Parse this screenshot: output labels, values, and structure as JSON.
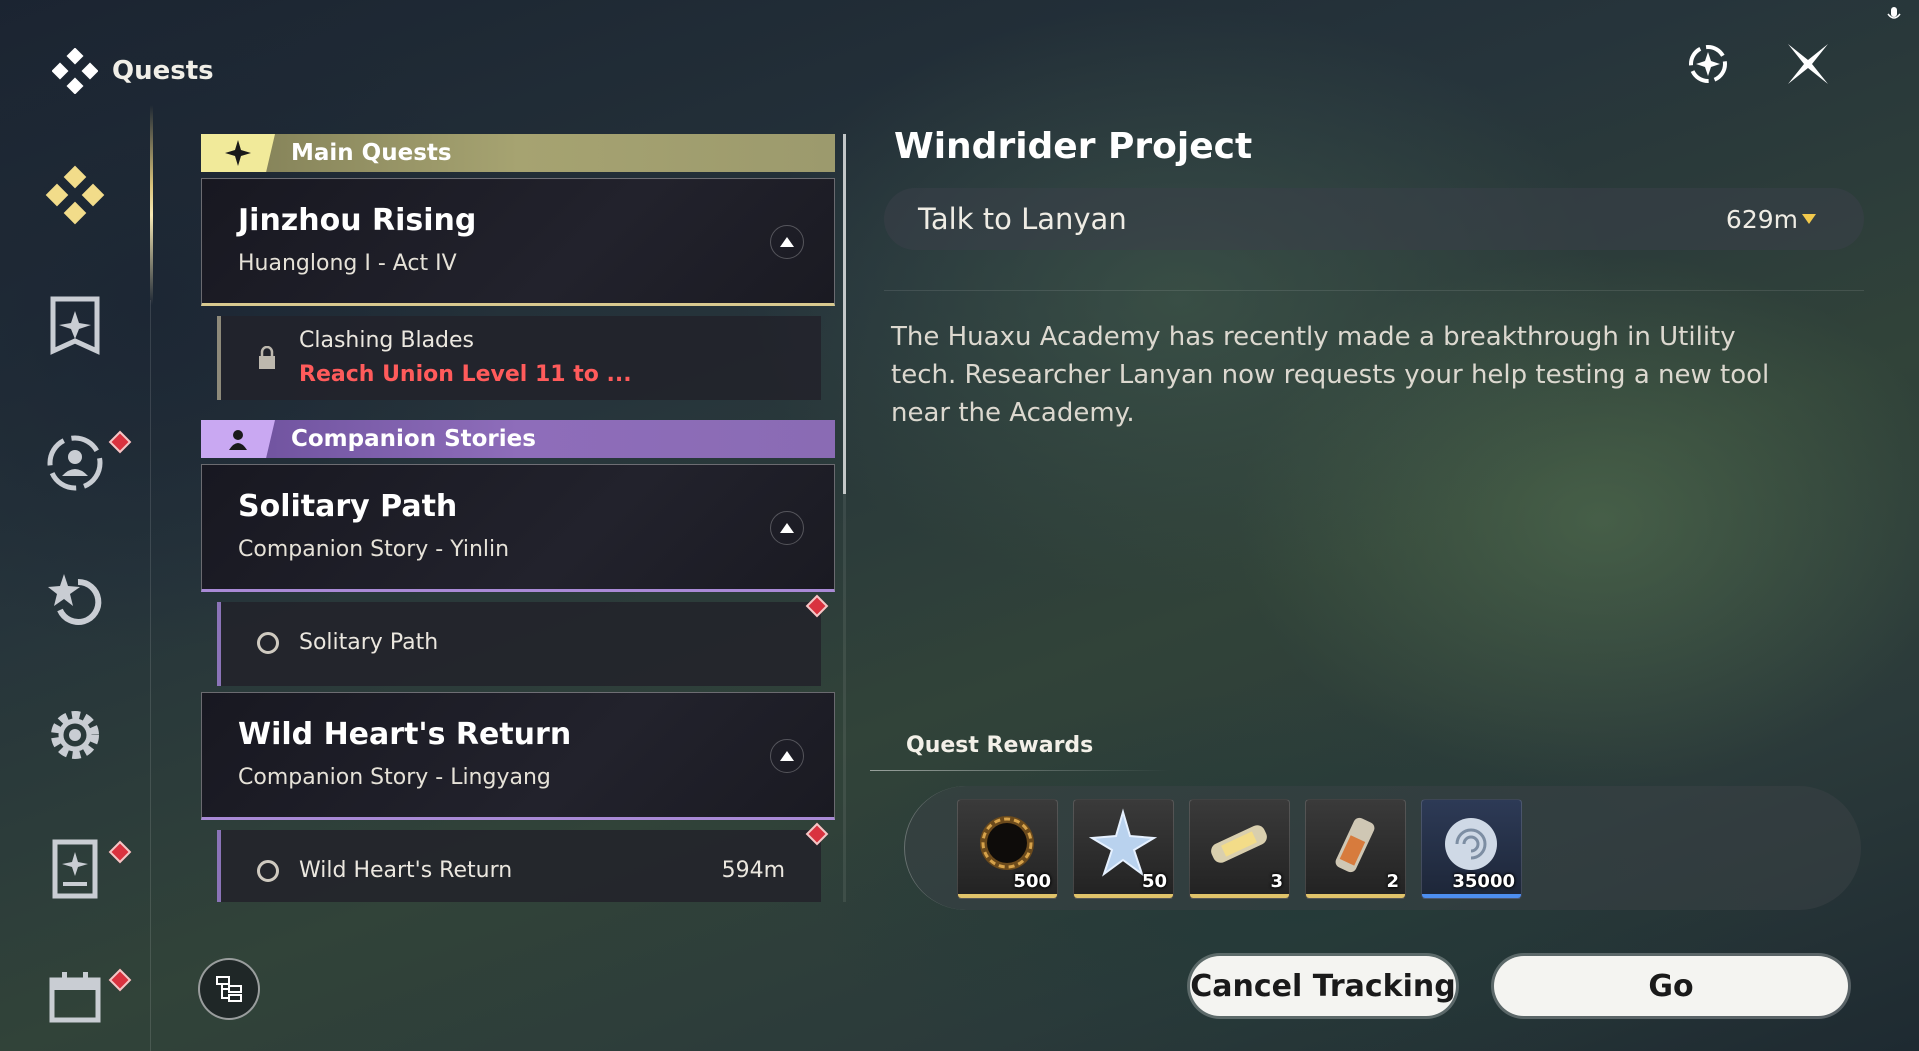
{
  "header": {
    "title": "Quests"
  },
  "sidebar": {
    "items": [
      {
        "icon": "quests-icon",
        "active": true,
        "alert": false
      },
      {
        "icon": "banner-shield-icon",
        "active": false,
        "alert": false
      },
      {
        "icon": "companion-icon",
        "active": false,
        "alert": true
      },
      {
        "icon": "star-return-icon",
        "active": false,
        "alert": false
      },
      {
        "icon": "settings-gear-icon",
        "active": false,
        "alert": false
      },
      {
        "icon": "journal-icon",
        "active": false,
        "alert": true
      },
      {
        "icon": "calendar-icon",
        "active": false,
        "alert": true
      }
    ]
  },
  "quest_list": {
    "main_category": "Main Quests",
    "companion_category": "Companion Stories",
    "main_quest": {
      "title": "Jinzhou Rising",
      "subtitle": "Huanglong I - Act IV"
    },
    "main_sub": {
      "title": "Clashing Blades",
      "requirement": "Reach Union Level 11 to ..."
    },
    "companion_1": {
      "title": "Solitary Path",
      "subtitle": "Companion Story - Yinlin"
    },
    "companion_1_sub": {
      "title": "Solitary Path"
    },
    "companion_2": {
      "title": "Wild Heart's Return",
      "subtitle": "Companion Story - Lingyang"
    },
    "companion_2_sub": {
      "title": "Wild Heart's Return",
      "distance": "594m"
    }
  },
  "detail": {
    "title": "Windrider Project",
    "objective": "Talk to Lanyan",
    "distance": "629m",
    "description": "The Huaxu Academy has recently made a breakthrough in Utility tech. Researcher Lanyan now requests your help testing a new tool near the Academy.",
    "rewards_label": "Quest Rewards",
    "rewards": [
      {
        "name": "black-core-icon",
        "count": "500",
        "rarity_color": "#e0c36a"
      },
      {
        "name": "crystal-star-icon",
        "count": "50",
        "rarity_color": "#e0c36a"
      },
      {
        "name": "energy-cell-icon",
        "count": "3",
        "rarity_color": "#e0c36a"
      },
      {
        "name": "potion-vial-icon",
        "count": "2",
        "rarity_color": "#e0c36a"
      },
      {
        "name": "shell-credit-icon",
        "count": "35000",
        "rarity_color": "#4d8ef0"
      }
    ]
  },
  "actions": {
    "cancel": "Cancel Tracking",
    "go": "Go"
  }
}
